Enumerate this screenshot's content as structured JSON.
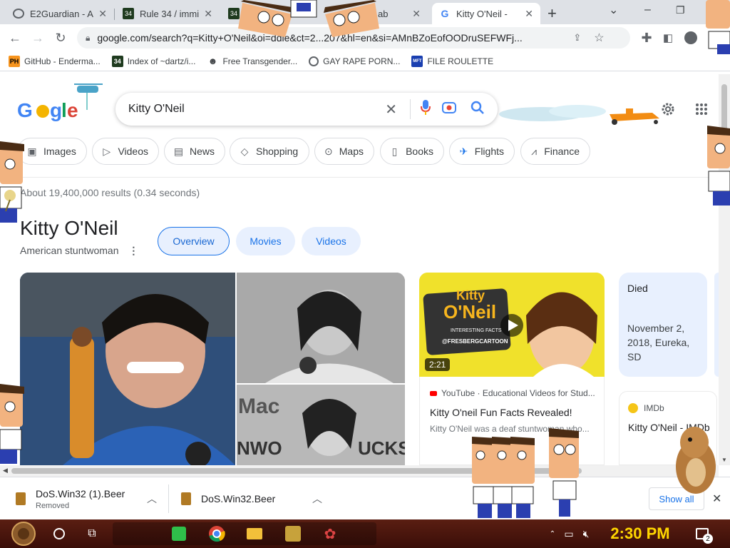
{
  "tabs": [
    {
      "title": "E2Guardian - A",
      "active": false
    },
    {
      "title": "Rule 34 / immi",
      "active": false
    },
    {
      "title": "34",
      "active": false
    },
    {
      "title": "ab",
      "active": false
    },
    {
      "title": "Kitty O'Neil -",
      "active": true
    }
  ],
  "tabstrip": {
    "new_tab": "+",
    "minimize": "–",
    "restore": "❐",
    "dropdown": "⌄"
  },
  "toolbar": {
    "url": "google.com/search?q=Kitty+O'Neil&oi=ddle&ct=2...207&hl=en&si=AMnBZoEofOODruSEFWFj..."
  },
  "bookmarks": [
    {
      "label": "GitHub - Enderma...",
      "icon": "PH"
    },
    {
      "label": "Index of ~dartz/i...",
      "icon": "34"
    },
    {
      "label": "Free Transgender...",
      "icon": "mask"
    },
    {
      "label": "GAY RAPE PORN...",
      "icon": "globe"
    },
    {
      "label": "FILE ROULETTE",
      "icon": "MFT"
    }
  ],
  "search": {
    "query": "Kitty O'Neil"
  },
  "chips": [
    "Images",
    "Videos",
    "News",
    "Shopping",
    "Maps",
    "Books",
    "Flights",
    "Finance"
  ],
  "results": {
    "stats": "About 19,400,000 results (0.34 seconds)"
  },
  "knowledge_panel": {
    "title": "Kitty O'Neil",
    "subtitle": "American stuntwoman",
    "tabs": [
      "Overview",
      "Movies",
      "Videos"
    ]
  },
  "video_card": {
    "duration": "2:21",
    "source": "YouTube · Educational Videos for Stud...",
    "title": "Kitty O'neil Fun Facts Revealed!",
    "snippet": "Kitty O'Neil was a deaf stuntwoman who...",
    "thumb_text_1": "Kitty",
    "thumb_text_2": "O'Neil",
    "thumb_text_3": "INTERESTING FACTS",
    "thumb_text_4": "@FRESBERGCARTOON"
  },
  "died_card": {
    "label": "Died",
    "value": "November 2, 2018, Eureka, SD"
  },
  "imdb_card": {
    "source": "IMDb",
    "title": "Kitty O'Neil - IMDb"
  },
  "downloads": [
    {
      "name": "DoS.Win32 (1).Beer",
      "status": "Removed"
    },
    {
      "name": "DoS.Win32.Beer",
      "status": ""
    }
  ],
  "download_bar": {
    "show_all": "Show all",
    "close": "✕"
  },
  "taskbar": {
    "clock": "2:30 PM",
    "notifications": "2"
  },
  "colors": {
    "accent": "#1a73e8",
    "taskbar": "#4a1810",
    "clock": "#ffd600"
  }
}
